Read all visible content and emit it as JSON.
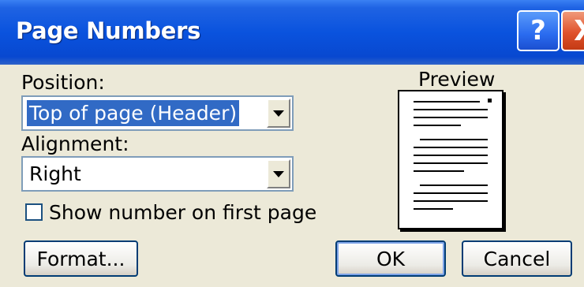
{
  "window": {
    "title": "Page Numbers"
  },
  "titlebar_buttons": {
    "help": "?",
    "close": "X"
  },
  "position": {
    "label": "Position:",
    "value": "Top of page (Header)"
  },
  "alignment": {
    "label": "Alignment:",
    "value": "Right"
  },
  "first_page": {
    "label": "Show number on first page",
    "checked": false
  },
  "preview": {
    "label": "Preview"
  },
  "buttons": {
    "format": "Format...",
    "ok": "OK",
    "cancel": "Cancel"
  }
}
